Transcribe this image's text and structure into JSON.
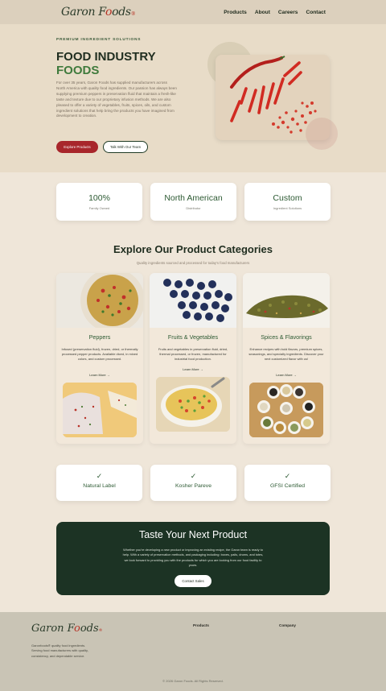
{
  "nav": {
    "logo_text": "Garon Foods",
    "links": [
      "Products",
      "About",
      "Careers",
      "Contact"
    ]
  },
  "hero": {
    "eyebrow": "PREMIUM INGREDIENT SOLUTIONS",
    "title_line1": "FOOD INDUSTRY",
    "title_line2": "FOODS",
    "paragraph": "For over 35 years, Garon Foods has supplied manufacturers across North America with quality food ingredients. Our passion has always been supplying premium peppers in preservation fluid that maintain a fresh-like taste and texture due to our proprietary infusion methods. We are also pleased to offer a variety of vegetables, fruits, spices, oils, and custom ingredient solutions that help bring the products you have imagined from development to creation.",
    "primary_button": "Explore Products",
    "secondary_button": "Talk With Our Team"
  },
  "stats": [
    {
      "value": "100%",
      "label": "Family Owned"
    },
    {
      "value": "North American",
      "label": "Distributor"
    },
    {
      "value": "Custom",
      "label": "Ingredient Solutions"
    }
  ],
  "categories": {
    "title": "Explore Our Product Categories",
    "subtitle": "Quality ingredients sourced and processed for today's food manufacturers",
    "items": [
      {
        "name": "Peppers",
        "desc": "Infused (preservation fluid), frozen, dried, or thermally processed pepper products. Available diced, in mixed colors, and custom processed.",
        "link": "Learn More →"
      },
      {
        "name": "Fruits & Vegetables",
        "desc": "Fruits and vegetables in preservation fluid, dried, thermal processed, or frozen, manufactured for industrial food production.",
        "link": "Learn More →"
      },
      {
        "name": "Spices & Flavorings",
        "desc": "Enhance recipes with bold flavors, premium spices, seasonings, and specialty ingredients. Discover your next customized flavor with us!",
        "link": "Learn More →"
      }
    ]
  },
  "certifications": [
    {
      "icon": "check-icon",
      "label": "Natural Label"
    },
    {
      "icon": "check-icon",
      "label": "Kosher Pareve"
    },
    {
      "icon": "check-icon",
      "label": "GFSI Certified"
    }
  ],
  "cta": {
    "title": "Taste Your Next Product",
    "paragraph": "Whether you're developing a new product or improving an existing recipe, the Garon team is ready to help. With a variety of preservation methods, and packaging including: boxes, pails, drums, and totes, we look forward to providing you with the products for which you are looking from our food facility to yours.",
    "button": "Contact Sales"
  },
  "footer": {
    "logo_text": "Garon Foods",
    "desc": "Garonfoods® quality food ingredients. Serving food manufacturers with quality, consistency, and dependable service.",
    "col1": "Products",
    "col2": "Company",
    "copyright": "© 2026 Garon Foods. All Rights Reserved."
  },
  "colors": {
    "brand_green": "#2d5a33",
    "brand_red": "#a8262b",
    "cta_bg": "#1c3324"
  }
}
